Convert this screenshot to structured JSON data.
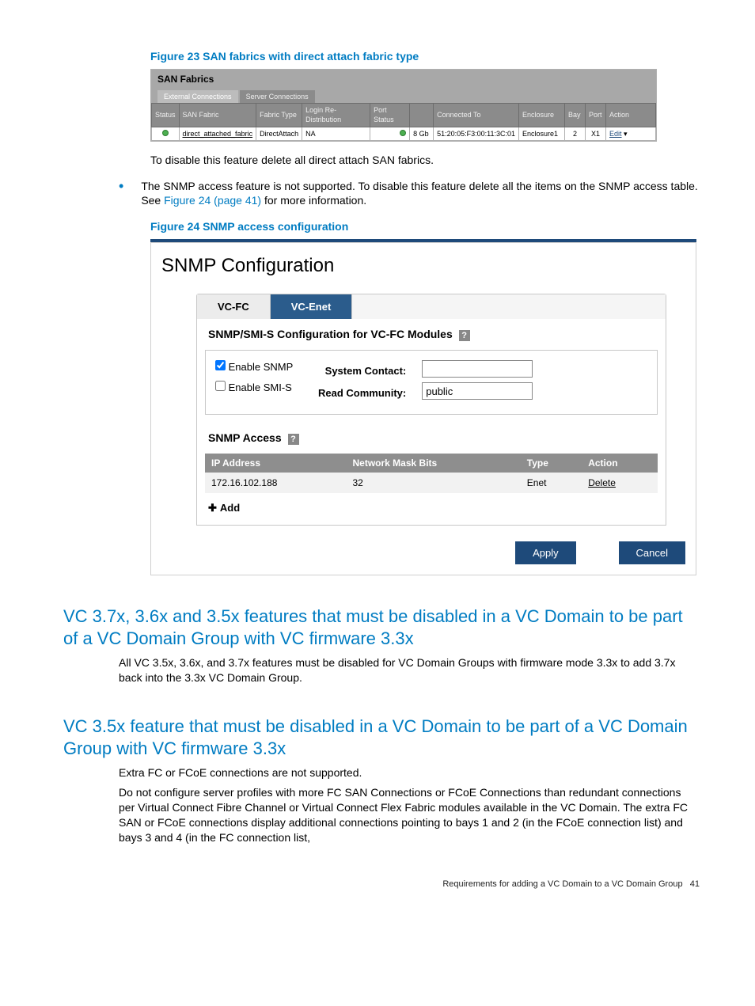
{
  "figure23": {
    "caption": "Figure 23 SAN fabrics with direct attach fabric type",
    "sanTitle": "SAN Fabrics",
    "subtabs": [
      "External Connections",
      "Server Connections"
    ],
    "headers": [
      "Status",
      "SAN Fabric",
      "Fabric Type",
      "Login Re-Distribution",
      "Port Status",
      "",
      "Connected To",
      "Enclosure",
      "Bay",
      "Port",
      "Action"
    ],
    "row": {
      "sanFabric": "direct_attached_fabric",
      "fabricType": "DirectAttach",
      "loginRe": "NA",
      "portSpeed": "8 Gb",
      "connectedTo": "51:20:05:F3:00:11:3C:01",
      "enclosure": "Enclosure1",
      "bay": "2",
      "port": "X1",
      "action": "Edit"
    }
  },
  "afterFig23": "To disable this feature delete all direct attach SAN fabrics.",
  "bullet": {
    "pre": "The SNMP access feature is not supported. To disable this feature delete all the items on the SNMP access table. See ",
    "link": "Figure 24 (page 41)",
    "post": " for more information."
  },
  "figure24": {
    "caption": "Figure 24 SNMP access configuration"
  },
  "snmp": {
    "title": "SNMP Configuration",
    "tabs": {
      "fc": "VC-FC",
      "enet": "VC-Enet"
    },
    "sectionHead": "SNMP/SMI-S Configuration for VC-FC Modules",
    "enableSnmp": "Enable SNMP",
    "enableSmis": "Enable SMI-S",
    "sysContact": "System Contact:",
    "readComm": "Read Community:",
    "readCommVal": "public",
    "accessHead": "SNMP Access",
    "accessHeaders": [
      "IP Address",
      "Network Mask Bits",
      "Type",
      "Action"
    ],
    "accessRow": {
      "ip": "172.16.102.188",
      "mask": "32",
      "type": "Enet",
      "action": "Delete"
    },
    "add": "Add",
    "apply": "Apply",
    "cancel": "Cancel"
  },
  "h2a": "VC 3.7x, 3.6x and 3.5x features that must be disabled in a VC Domain to be part of a VC Domain Group with VC firmware 3.3x",
  "p2a": "All VC 3.5x, 3.6x, and 3.7x features must be disabled for VC Domain Groups with firmware mode 3.3x to add 3.7x back into the 3.3x VC Domain Group.",
  "h2b": "VC 3.5x feature that must be disabled in a VC Domain to be part of a VC Domain Group with VC firmware 3.3x",
  "p2b1": "Extra FC or FCoE connections are not supported.",
  "p2b2": "Do not configure server profiles with more FC SAN Connections or FCoE Connections than redundant connections per Virtual Connect Fibre Channel or Virtual Connect Flex Fabric modules available in the VC Domain. The extra FC SAN or FCoE connections display additional connections pointing to bays 1 and 2 (in the FCoE connection list) and bays 3 and 4 (in the FC connection list,",
  "footer": {
    "text": "Requirements for adding a VC Domain to a VC Domain Group",
    "page": "41"
  }
}
